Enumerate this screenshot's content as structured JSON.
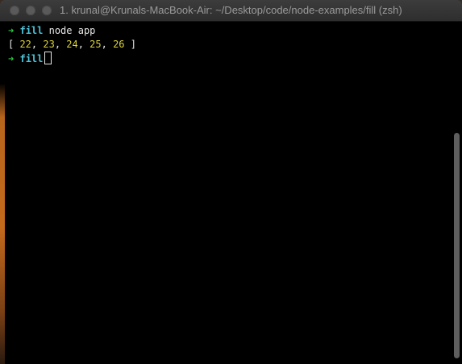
{
  "window": {
    "title": "1. krunal@Krunals-MacBook-Air: ~/Desktop/code/node-examples/fill (zsh)"
  },
  "terminal": {
    "prompt_symbol": "➜",
    "lines": [
      {
        "type": "prompt",
        "dir": "fill",
        "command": "node app"
      },
      {
        "type": "output",
        "open": "[ ",
        "values": [
          "22",
          "23",
          "24",
          "25",
          "26"
        ],
        "close": " ]"
      },
      {
        "type": "prompt",
        "dir": "fill",
        "command": ""
      }
    ]
  },
  "colors": {
    "prompt_arrow": "#27c93f",
    "directory": "#4fc3d9",
    "number": "#d9d23a",
    "background": "#000000"
  }
}
